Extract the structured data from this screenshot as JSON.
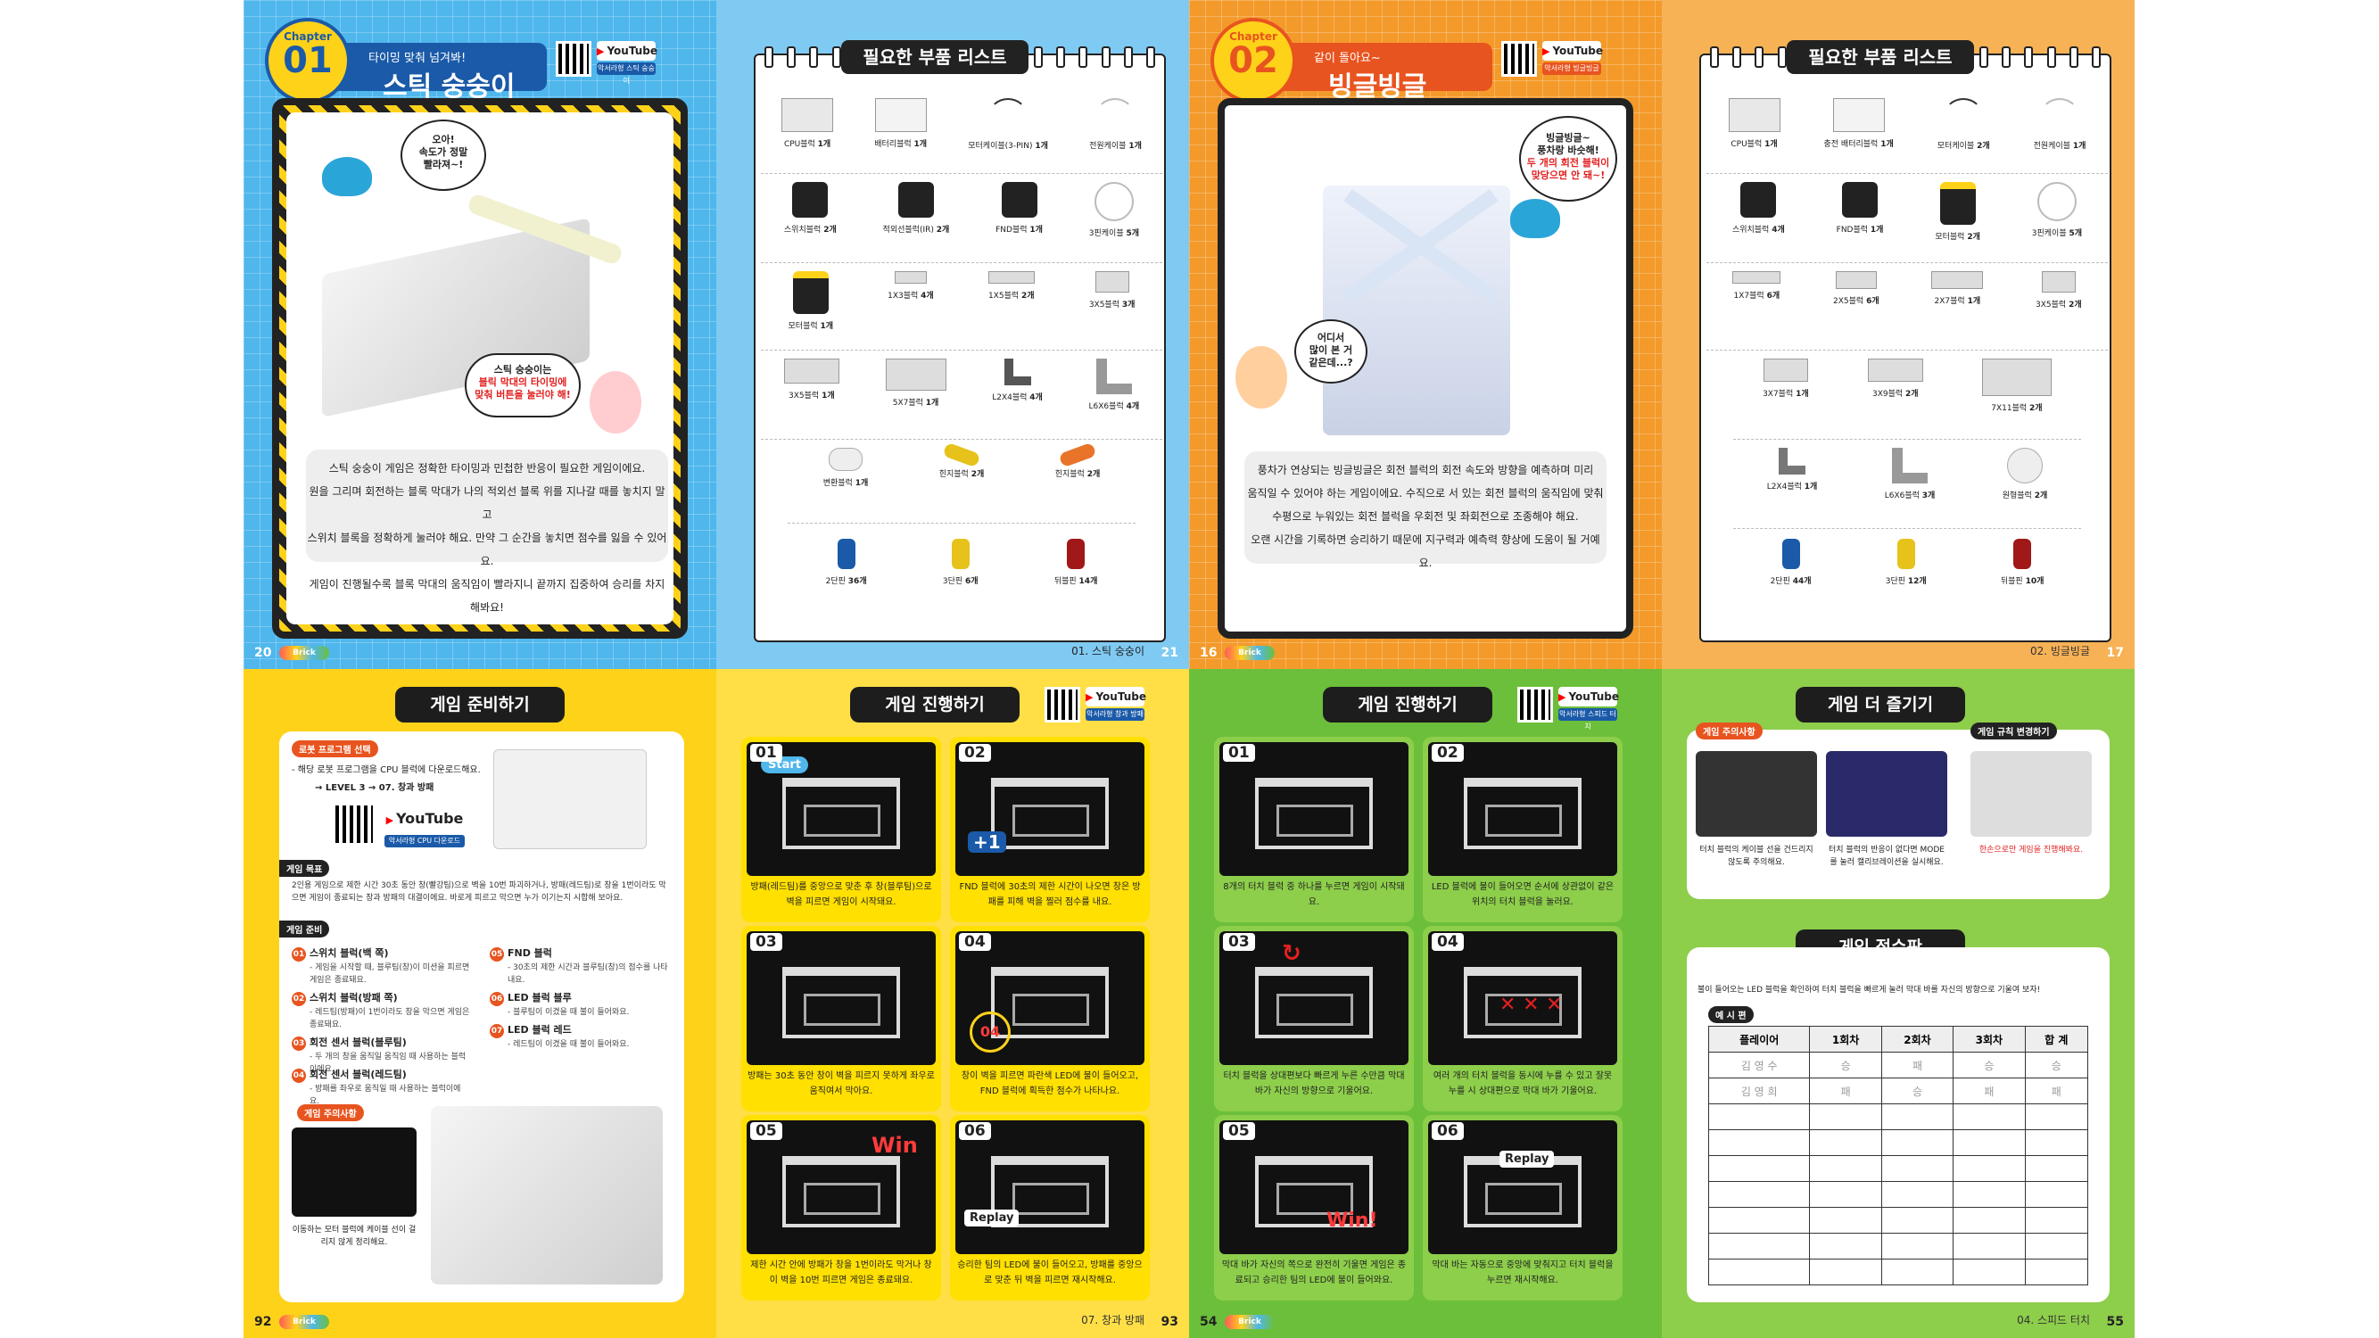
{
  "p20": {
    "chapter_label": "Chapter",
    "chapter_num": "01",
    "subtitle": "타이밍 맞춰 넘겨봐!",
    "title": "스틱 숭숭이",
    "youtube": "YouTube",
    "youtube_sub": "악서라형 스틱 숭숭이",
    "bubble1": [
      "오아!",
      "속도가 정말",
      "빨라져~!"
    ],
    "bubble2": [
      "스틱 숭숭이는",
      "블릭 막대의 타이밍에",
      "맞춰 버튼을 눌러야 해!"
    ],
    "desc": [
      "스틱 숭숭이 게임은 정확한 타이밍과 민첩한 반응이 필요한 게임이에요.",
      "원을 그리며 회전하는 블록 막대가 나의 적외선 블록 위를 지나갈 때를 놓치지 말고",
      "스위치 블록을 정확하게 눌러야 해요. 만약 그 순간을 놓치면 점수를 잃을 수 있어요.",
      "게임이 진행될수록 블록 막대의 움직임이 빨라지니 끝까지 집중하여 승리를 차지해봐요!"
    ],
    "page_num": "20"
  },
  "p21": {
    "title": "필요한 부품 리스트",
    "rows": [
      [
        {
          "name": "CPU블럭",
          "cnt": "1개"
        },
        {
          "name": "배터리블럭",
          "cnt": "1개"
        },
        {
          "name": "모터케이블(3-PIN)",
          "cnt": "1개"
        },
        {
          "name": "전원케이블",
          "cnt": "1개"
        }
      ],
      [
        {
          "name": "스위치블럭",
          "cnt": "2개"
        },
        {
          "name": "적외선블럭(IR)",
          "cnt": "2개"
        },
        {
          "name": "FND블럭",
          "cnt": "1개"
        },
        {
          "name": "3핀케이블",
          "cnt": "5개"
        }
      ],
      [
        {
          "name": "모터블럭",
          "cnt": "1개"
        },
        {
          "name": "1X3블럭",
          "cnt": "4개"
        },
        {
          "name": "1X5블럭",
          "cnt": "2개"
        },
        {
          "name": "3X5블럭",
          "cnt": "3개"
        }
      ],
      [
        {
          "name": "3X5블럭",
          "cnt": "1개"
        },
        {
          "name": "5X7블럭",
          "cnt": "1개"
        },
        {
          "name": "L2X4블럭",
          "cnt": "4개"
        },
        {
          "name": "L6X6블럭",
          "cnt": "4개"
        }
      ],
      [
        {
          "name": "변환블럭",
          "cnt": "1개"
        },
        {
          "name": "힌지블럭",
          "cnt": "2개"
        },
        {
          "name": "힌지블럭",
          "cnt": "2개"
        }
      ],
      [
        {
          "name": "2단핀",
          "cnt": "36개"
        },
        {
          "name": "3단핀",
          "cnt": "6개"
        },
        {
          "name": "뒤블핀",
          "cnt": "14개"
        }
      ]
    ],
    "footer": "01. 스틱 숭숭이",
    "page_num": "21"
  },
  "p16": {
    "chapter_label": "Chapter",
    "chapter_num": "02",
    "subtitle": "같이 돌아요~",
    "title": "빙글빙글",
    "youtube": "YouTube",
    "youtube_sub": "악서라형 빙글빙글",
    "bubble1": [
      "빙글빙글~",
      "풍차랑 바슷해!",
      "두 개의 회전 블럭이",
      "맞당으면 안 돼~!"
    ],
    "bubble2": [
      "어디서",
      "많이 본 거",
      "같은데...?"
    ],
    "desc": [
      "풍차가 연상되는 빙글빙글은 회전 블럭의 회전 속도와 방향을 예측하며 미리",
      "움직일 수 있어야 하는 게임이에요. 수직으로 서 있는 회전 블럭의 움직임에 맞춰",
      "수평으로 누워있는 회전 블럭을 우회전 및 좌회전으로 조종해야 해요.",
      "오랜 시간을 기록하면 승리하기 때문에 지구력과 예측력 향상에 도움이 될 거예요."
    ],
    "page_num": "16"
  },
  "p17": {
    "title": "필요한 부품 리스트",
    "rows": [
      [
        {
          "name": "CPU블럭",
          "cnt": "1개"
        },
        {
          "name": "충전 배터리블럭",
          "cnt": "1개"
        },
        {
          "name": "모터케이블",
          "cnt": "2개"
        },
        {
          "name": "전원케이블",
          "cnt": "1개"
        }
      ],
      [
        {
          "name": "스위치블럭",
          "cnt": "4개"
        },
        {
          "name": "FND블럭",
          "cnt": "1개"
        },
        {
          "name": "모터블럭",
          "cnt": "2개"
        },
        {
          "name": "3핀케이블",
          "cnt": "5개"
        }
      ],
      [
        {
          "name": "1X7블럭",
          "cnt": "6개"
        },
        {
          "name": "2X5블럭",
          "cnt": "6개"
        },
        {
          "name": "2X7블럭",
          "cnt": "1개"
        },
        {
          "name": "3X5블럭",
          "cnt": "2개"
        }
      ],
      [
        {
          "name": "3X7블럭",
          "cnt": "1개"
        },
        {
          "name": "3X9블럭",
          "cnt": "2개"
        },
        {
          "name": "7X11블럭",
          "cnt": "2개"
        }
      ],
      [
        {
          "name": "L2X4블럭",
          "cnt": "1개"
        },
        {
          "name": "L6X6블럭",
          "cnt": "3개"
        },
        {
          "name": "원형블럭",
          "cnt": "2개"
        }
      ],
      [
        {
          "name": "2단핀",
          "cnt": "44개"
        },
        {
          "name": "3단핀",
          "cnt": "12개"
        },
        {
          "name": "뒤블핀",
          "cnt": "10개"
        }
      ]
    ],
    "footer": "02. 빙글빙글",
    "page_num": "17"
  },
  "p92": {
    "title": "게임 준비하기",
    "robot_title": "로봇 프로그램 선택",
    "robot_desc": "- 해당 로봇 프로그램을 CPU 블럭에 다운로드해요.",
    "robot_path": "→ LEVEL 3 → 07. 창과 방패",
    "youtube": "YouTube",
    "youtube_sub": "악서라형 CPU 다운로드",
    "goal_title": "게임 목표",
    "goal_text": "2인용 게임으로 제한 시간 30초 동안 창(빨강팀)으로 벽을 10번 파괴하거나, 방패(레드팀)로 창을 1번이라도 막으면 게임이 종료되는 창과 방패의 대결이에요. 바로게 피르고 막으면 누가 이기는지 시합해 보아요.",
    "prep_title": "게임 준비",
    "items_left": [
      {
        "n": "01",
        "t": "스위치 블럭(백 쪽)",
        "d": "- 게임을 시작할 때, 블루팀(창)이 미션을 피르면 게임은 종료돼요."
      },
      {
        "n": "02",
        "t": "스위치 블럭(방패 쪽)",
        "d": "- 레드팀(방패)이 1번이라도 창을 막으면 게임은 종료돼요."
      },
      {
        "n": "03",
        "t": "회전 센서 블럭(블루팀)",
        "d": "- 두 개의 창을 움직일 움직임 때 사용하는 블럭이에요."
      },
      {
        "n": "04",
        "t": "회전 센서 블럭(레드팀)",
        "d": "- 방패를 좌우로 움직일 때 사용하는 블럭이에요."
      }
    ],
    "items_right": [
      {
        "n": "05",
        "t": "FND 블럭",
        "d": "- 30초의 제한 시간과 블루팀(창)의 점수를 나타내요."
      },
      {
        "n": "06",
        "t": "LED 블럭 블루",
        "d": "- 블루팀이 이겼을 때 불이 들어와요."
      },
      {
        "n": "07",
        "t": "LED 블럭 레드",
        "d": "- 레드팀이 이겼을 때 불이 들어와요."
      }
    ],
    "caution_title": "게임 주의사항",
    "caution_text": "이동하는 모터 블럭에 케이블 선이 걸리지 않게 정리해요.",
    "page_num": "92"
  },
  "p93": {
    "title": "게임 진행하기",
    "youtube": "YouTube",
    "youtube_sub": "악서라형 창과 방패",
    "steps": [
      {
        "num": "01",
        "overlay": "Start",
        "txt": "방패(레드팀)를 중앙으로 맞춘 후 창(블루팀)으로 벽을 피르면 게임이 시작돼요."
      },
      {
        "num": "02",
        "overlay": "+1",
        "txt": "FND 블럭에 30초의 제한 시간이 나오면 창은 방패를 피해 벽을 찔러 점수를 내요."
      },
      {
        "num": "03",
        "overlay": "",
        "txt": "방패는 30초 동안 창이 벽을 피르지 못하게 좌우로 움직여서 막아요."
      },
      {
        "num": "04",
        "overlay": "04",
        "txt": "창이 벽을 피르면 파란색 LED에 불이 들어오고, FND 블럭에 획득한 점수가 나타나요."
      },
      {
        "num": "05",
        "overlay": "Win",
        "txt": "제한 시간 안에 방패가 창을 1번이라도 막거나 창이 벽을 10번 피르면 게임은 종료돼요."
      },
      {
        "num": "06",
        "overlay": "Replay",
        "txt": "승리한 팀의 LED에 불이 들어오고, 방패를 중앙으로 맞춘 뒤 벽을 피르면 재시작해요."
      }
    ],
    "footer": "07. 창과 방패",
    "page_num": "93"
  },
  "p54": {
    "title": "게임 진행하기",
    "youtube": "YouTube",
    "youtube_sub": "악서라형 스피드 터치",
    "steps": [
      {
        "num": "01",
        "overlay": "",
        "txt": "8개의 터치 블럭 중 하나를 누르면 게임이 시작돼요."
      },
      {
        "num": "02",
        "overlay": "",
        "txt": "LED 블럭에 불이 들어오면 순서에 상관없이 같은 위치의 터치 블럭을 눌러요."
      },
      {
        "num": "03",
        "overlay": "",
        "txt": "터치 블럭을 상대편보다 빠르게 누른 수만큼 막대 바가 자신의 방향으로 기울어요."
      },
      {
        "num": "04",
        "overlay": "",
        "txt": "여러 개의 터치 블럭을 동시에 누를 수 있고 잘못 누를 시 상대편으로 막대 바가 기울어요."
      },
      {
        "num": "05",
        "overlay": "Win!",
        "txt": "막대 바가 자신의 쪽으로 완전히 기울면 게임은 종료되고 승리한 팀의 LED에 불이 들어와요."
      },
      {
        "num": "06",
        "overlay": "Replay",
        "txt": "막대 바는 자동으로 중앙에 맞춰지고 터치 블럭을 누르면 재시작해요."
      }
    ],
    "page_num": "54"
  },
  "p55": {
    "title": "게임 더 즐기기",
    "caution_title": "게임 주의사항",
    "rule_title": "게임 규칙 변경하기",
    "caution1": "터치 블럭의 케이블 선을 건드리지 않도록 주의해요.",
    "caution2": "터치 블럭의 반응이 없다면 MODE를 눌러 캘리브레이션을 실시해요.",
    "rule_text": "한손으로만 게임을 진행해봐요.",
    "score_title": "게임 점수판",
    "score_desc": "불이 들어오는 LED 블럭을 확인하여 터치 블럭을 빠르게 눌러 막대 바를 자신의 방향으로 기울여 보자!",
    "score_example": "예 시 편",
    "score_headers": [
      "플레이어",
      "1회차",
      "2회차",
      "3회차",
      "합 계"
    ],
    "score_rows": [
      [
        "김 영 수",
        "승",
        "패",
        "승",
        "승"
      ],
      [
        "김 영 희",
        "패",
        "승",
        "패",
        "패"
      ]
    ],
    "footer": "04. 스피드 터치",
    "page_num": "55"
  },
  "logo_text": "Brick"
}
